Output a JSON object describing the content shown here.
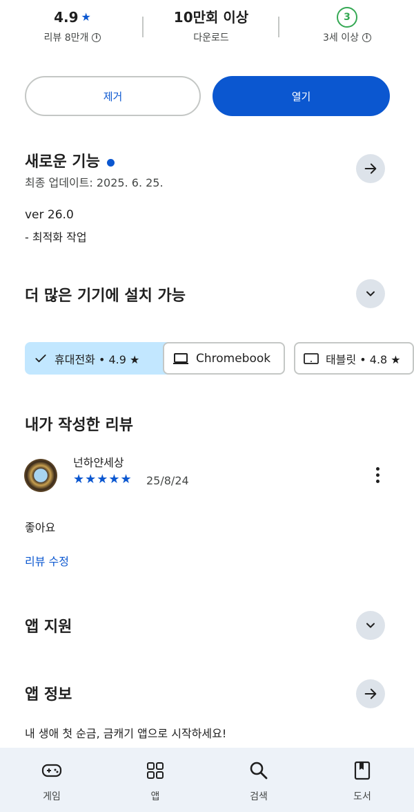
{
  "stats": {
    "rating_value": "4.9",
    "rating_caption": "리뷰 8만개",
    "downloads_value": "10만회 이상",
    "downloads_caption": "다운로드",
    "age_rating_value": "3",
    "age_caption": "3세 이상"
  },
  "actions": {
    "remove_label": "제거",
    "open_label": "열기"
  },
  "whats_new": {
    "title": "새로운 기능",
    "last_updated": "최종 업데이트: 2025. 6. 25.",
    "version": "ver 26.0",
    "notes": "- 최적화 작업"
  },
  "devices": {
    "title": "더 많은 기기에 설치 가능",
    "chips": [
      {
        "label": "휴대전화 • 4.9 ★",
        "selected": true
      },
      {
        "label": "Chromebook",
        "selected": false
      },
      {
        "label": "태블릿 • 4.8 ★",
        "selected": false
      }
    ]
  },
  "my_review": {
    "title": "내가 작성한 리뷰",
    "author": "넌하얀세상",
    "stars": "★★★★★",
    "rating": 5,
    "date": "25/8/24",
    "text": "좋아요",
    "edit_label": "리뷰 수정"
  },
  "app_support": {
    "title": "앱 지원"
  },
  "app_info": {
    "title": "앱 정보",
    "description": "내 생애 첫 순금, 금캐기 앱으로 시작하세요!"
  },
  "bottom_nav": {
    "items": [
      {
        "label": "게임",
        "icon": "gamepad-icon"
      },
      {
        "label": "앱",
        "icon": "apps-grid-icon"
      },
      {
        "label": "검색",
        "icon": "search-icon"
      },
      {
        "label": "도서",
        "icon": "book-icon"
      }
    ]
  },
  "colors": {
    "accent": "#0b57d0",
    "chip_selected": "#c2e7ff",
    "round_button": "#dde3ea",
    "nav_background": "#edf2f8",
    "age_rating_green": "#34a853"
  }
}
